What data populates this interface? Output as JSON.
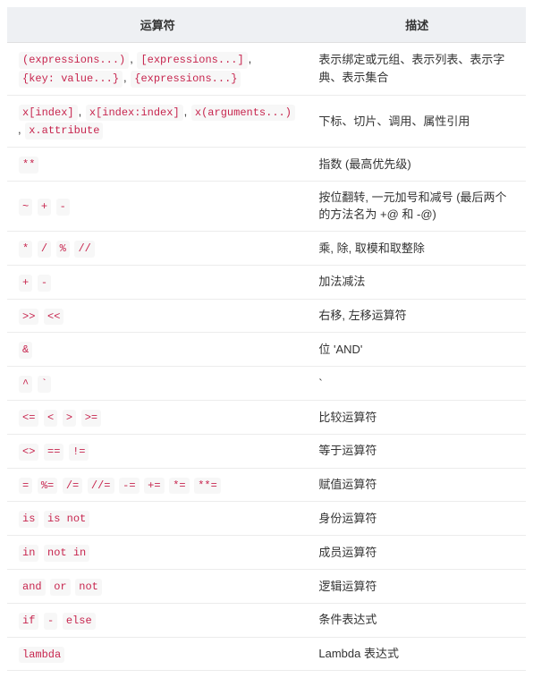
{
  "table": {
    "headers": {
      "operator": "运算符",
      "description": "描述"
    },
    "rows": [
      {
        "ops": [
          "(expressions...)",
          "[expressions...]",
          "{key: value...}",
          "{expressions...}"
        ],
        "desc": "表示绑定或元组、表示列表、表示字典、表示集合"
      },
      {
        "ops": [
          "x[index]",
          "x[index:index]",
          "x(arguments...)",
          "x.attribute"
        ],
        "desc": "下标、切片、调用、属性引用"
      },
      {
        "ops": [
          "**"
        ],
        "desc": "指数 (最高优先级)"
      },
      {
        "ops": [
          "~",
          "+",
          "-"
        ],
        "desc": "按位翻转, 一元加号和减号 (最后两个的方法名为 +@ 和 -@)"
      },
      {
        "ops": [
          "*",
          "/",
          "%",
          "//"
        ],
        "desc": "乘, 除, 取模和取整除"
      },
      {
        "ops": [
          "+",
          "-"
        ],
        "desc": "加法减法"
      },
      {
        "ops": [
          ">>",
          "<<"
        ],
        "desc": "右移, 左移运算符"
      },
      {
        "ops": [
          "&"
        ],
        "desc": "位 'AND'"
      },
      {
        "ops": [
          "^",
          "`"
        ],
        "desc": "`"
      },
      {
        "ops": [
          "<=",
          "<",
          ">",
          ">="
        ],
        "desc": "比较运算符"
      },
      {
        "ops": [
          "<>",
          "==",
          "!="
        ],
        "desc": "等于运算符"
      },
      {
        "ops": [
          "=",
          "%=",
          "/=",
          "//=",
          "-=",
          "+=",
          "*=",
          "**="
        ],
        "desc": "赋值运算符"
      },
      {
        "ops": [
          "is",
          "is not"
        ],
        "desc": "身份运算符"
      },
      {
        "ops": [
          "in",
          "not in"
        ],
        "desc": "成员运算符"
      },
      {
        "ops": [
          "and",
          "or",
          "not"
        ],
        "desc": "逻辑运算符"
      },
      {
        "ops": [
          "if",
          "-",
          "else"
        ],
        "desc": "条件表达式"
      },
      {
        "ops": [
          "lambda"
        ],
        "desc": "Lambda 表达式"
      }
    ]
  }
}
